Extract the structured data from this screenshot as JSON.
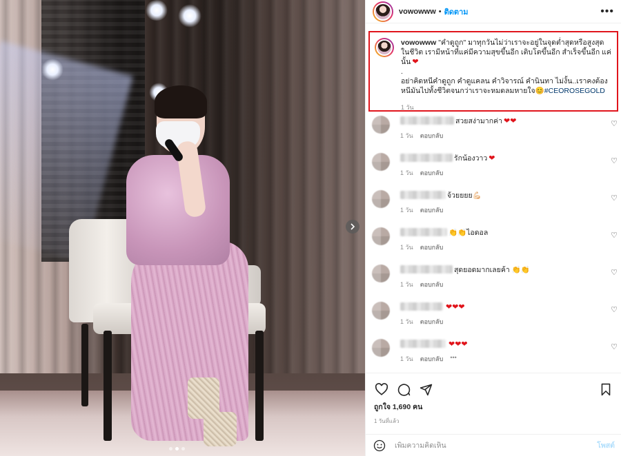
{
  "post": {
    "username": "vowowww",
    "follow_label": "ติดตาม",
    "separator": "•",
    "more_label": "•••"
  },
  "caption": {
    "username": "vowowww",
    "line1": " \"คำดูถูก\" มาทุกวันไม่ว่าเราจะอยู่ในจุดต่ำสุดหรือสูงสุดในชีวิต เรามีหน้าที่แค่มีความสุขขึ้นอีก เติบโตขึ้นอีก สำเร็จขึ้นอีก แค่นั้น",
    "line1_emoji": "❤",
    "dot": ".",
    "line2": "อย่าคิดหนีคำดูถูก คำดูแคลน คำวิจารณ์ คำนินทา ไม่งั้น..เราคงต้องหนีมันไปทั้งชีวิตจนกว่าเราจะหมดลมหายใจ",
    "line2_emoji": "😊",
    "hashtag": "#CEOROSEGOLD",
    "time": "1 วัน"
  },
  "comments": [
    {
      "text": "สวยสง่ามากค่า",
      "hearts": "❤❤",
      "time": "1 วัน",
      "reply": "ตอบกลับ"
    },
    {
      "text": "รักน้องวาว",
      "hearts": "❤",
      "time": "1 วัน",
      "reply": "ตอบกลับ"
    },
    {
      "text": "จ้วยยยย💪🏻",
      "hearts": "",
      "time": "1 วัน",
      "reply": "ตอบกลับ"
    },
    {
      "text": "👏👏ไอดอล",
      "hearts": "",
      "time": "1 วัน",
      "reply": "ตอบกลับ"
    },
    {
      "text": "สุดยอดมากเลยค้า 👏👏",
      "hearts": "",
      "time": "1 วัน",
      "reply": "ตอบกลับ"
    },
    {
      "text": "",
      "hearts": "❤❤❤",
      "time": "1 วัน",
      "reply": "ตอบกลับ"
    },
    {
      "text": "",
      "hearts": "❤❤❤",
      "time": "1 วัน",
      "reply": "ตอบกลับ",
      "more": "•••"
    }
  ],
  "stats": {
    "likes": "ถูกใจ 1,690 คน",
    "posted": "1 วันที่แล้ว"
  },
  "add_comment": {
    "placeholder": "เพิ่มความคิดเห็น",
    "post_label": "โพสต์"
  },
  "colors": {
    "accent": "#0095f6",
    "highlight_border": "#e0141b",
    "heart": "#e0141b"
  },
  "carousel": {
    "next_icon": "chevron-right-icon",
    "dots": 3,
    "active_dot": 2
  }
}
